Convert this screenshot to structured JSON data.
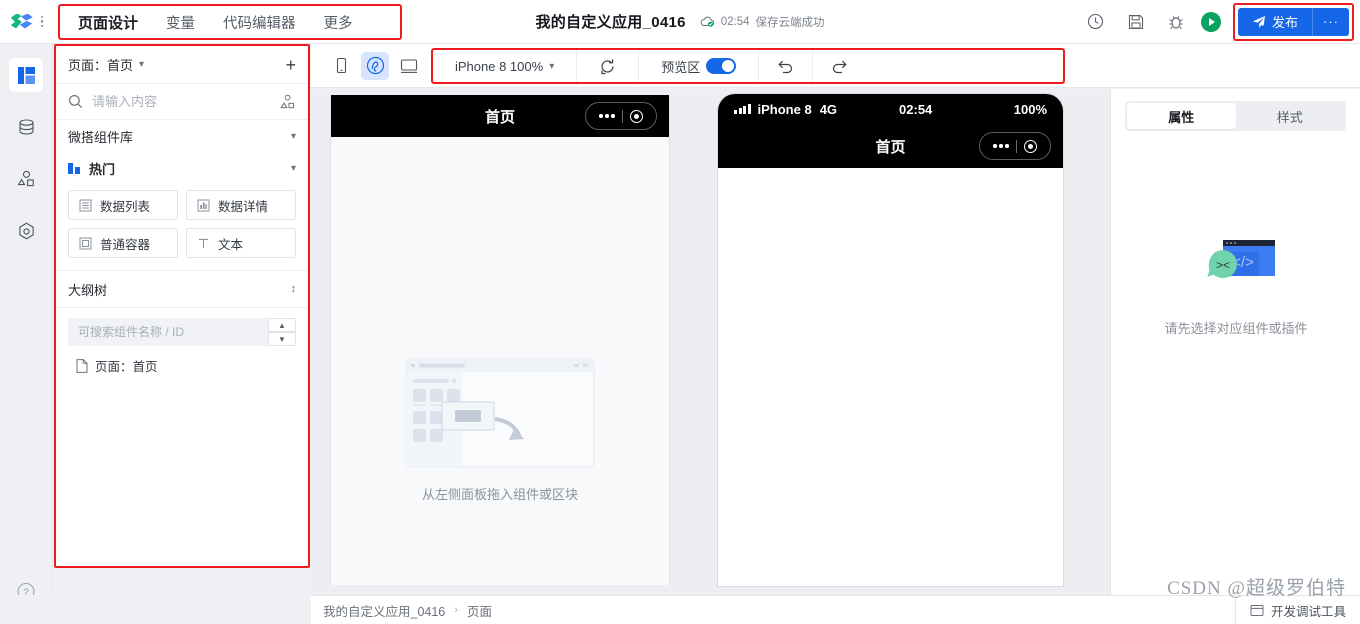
{
  "header": {
    "logo_name": "cloudbase-logo",
    "menu": [
      {
        "label": "页面设计",
        "active": true
      },
      {
        "label": "变量",
        "active": false
      },
      {
        "label": "代码编辑器",
        "active": false
      },
      {
        "label": "更多",
        "active": false
      }
    ],
    "app_title": "我的自定义应用_0416",
    "save_time": "02:54",
    "save_status": "保存云端成功",
    "icons": [
      "history-icon",
      "save-icon",
      "bug-icon",
      "play-icon"
    ],
    "publish_label": "发布",
    "publish_more": "···",
    "accent_color": "#1667e8",
    "highlight_color": "#ee1c1c"
  },
  "rail": {
    "items": [
      {
        "name": "layout-panel-icon",
        "active": true
      },
      {
        "name": "database-icon",
        "active": false
      },
      {
        "name": "components-icon",
        "active": false
      },
      {
        "name": "plugin-icon",
        "active": false
      }
    ],
    "help": "help-icon"
  },
  "left_panel": {
    "page_row": {
      "label": "页面：首页",
      "add": "+"
    },
    "search": {
      "placeholder": "请输入内容",
      "value": "",
      "trailing_icon": "shapes-icon"
    },
    "library_title": "微搭组件库",
    "hot_group": "热门",
    "components": [
      {
        "label": "数据列表",
        "icon": "list-icon"
      },
      {
        "label": "数据详情",
        "icon": "chart-icon"
      },
      {
        "label": "普通容器",
        "icon": "container-icon"
      },
      {
        "label": "文本",
        "icon": "text-icon"
      }
    ],
    "outline_title": "大纲树",
    "tree_search": {
      "placeholder": "可搜索组件名称 / ID",
      "value": ""
    },
    "tree_items": [
      {
        "label": "页面：首页",
        "icon": "file-icon"
      }
    ]
  },
  "toolbar": {
    "device_modes": [
      {
        "name": "mobile-icon",
        "active": false
      },
      {
        "name": "miniprogram-icon",
        "active": true
      },
      {
        "name": "desktop-icon",
        "active": false
      }
    ],
    "device_select": "iPhone 8 100%",
    "refresh_icon": "refresh-icon",
    "preview_label": "预览区",
    "preview_on": true,
    "undo_icon": "undo-icon",
    "redo_icon": "redo-icon"
  },
  "canvas": {
    "stage": {
      "nav_title": "首页",
      "drop_hint": "从左侧面板拖入组件或区块"
    },
    "phone": {
      "carrier": "iPhone 8",
      "network": "4G",
      "time": "02:54",
      "battery": "100%",
      "nav_title": "首页"
    }
  },
  "properties": {
    "tabs": [
      {
        "label": "属性",
        "active": true
      },
      {
        "label": "样式",
        "active": false
      }
    ],
    "empty_text": "请先选择对应组件或插件"
  },
  "footer": {
    "breadcrumb": [
      "我的自定义应用_0416",
      "页面"
    ],
    "separator": "›",
    "devtools_label": "开发调试工具",
    "watermark": "CSDN @超级罗伯特"
  }
}
